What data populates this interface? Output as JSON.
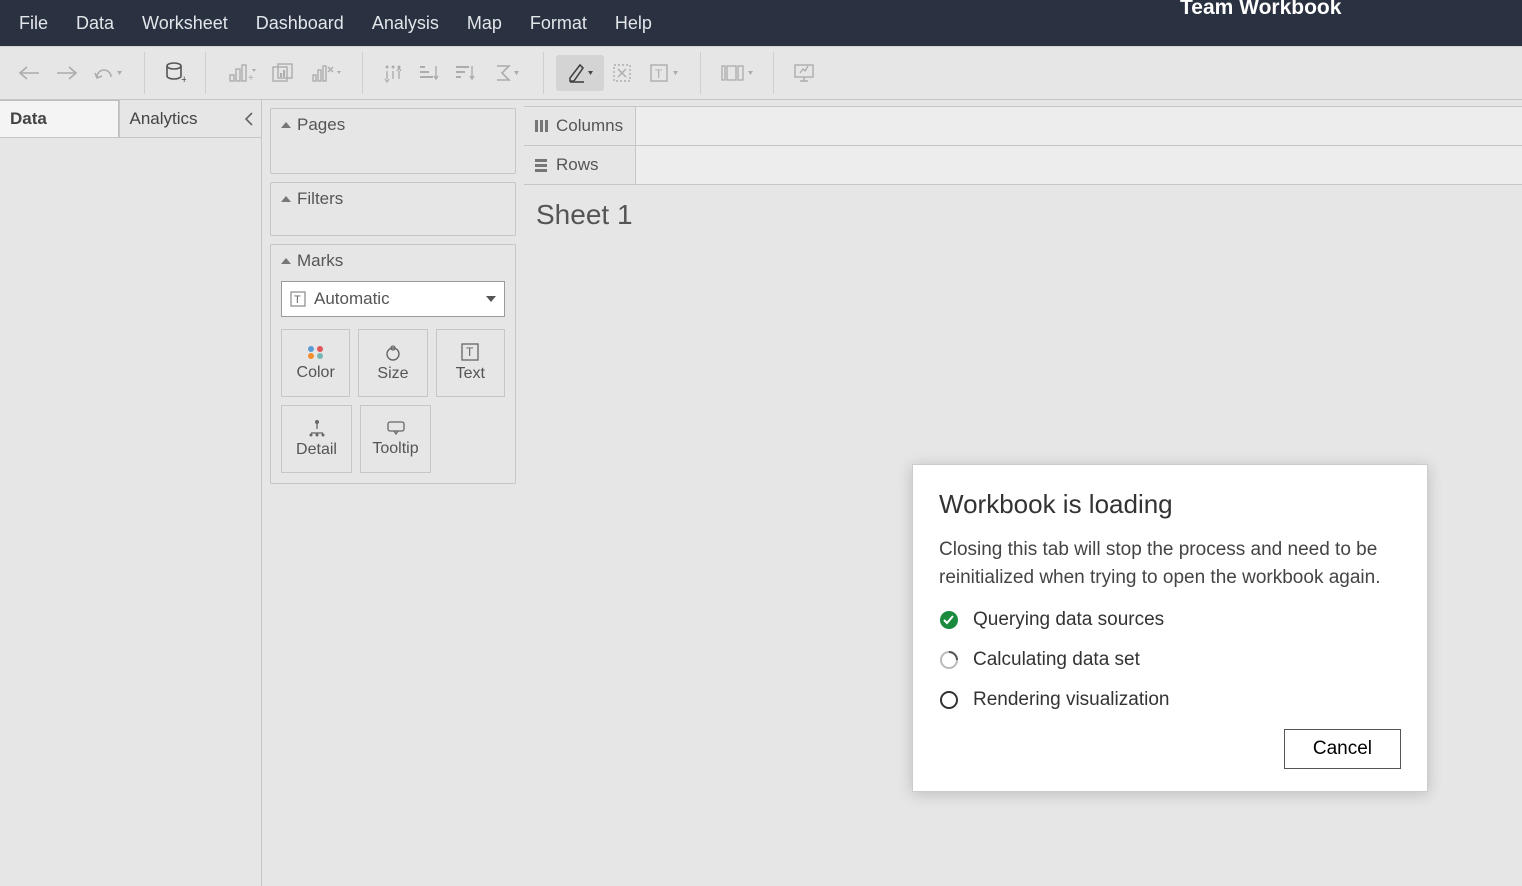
{
  "header": {
    "workbook_title": "Team Workbook"
  },
  "menubar": {
    "items": [
      "File",
      "Data",
      "Worksheet",
      "Dashboard",
      "Analysis",
      "Map",
      "Format",
      "Help"
    ]
  },
  "side": {
    "tab_data": "Data",
    "tab_analytics": "Analytics"
  },
  "cards": {
    "pages": "Pages",
    "filters": "Filters",
    "marks": "Marks",
    "mark_type": "Automatic",
    "cells": {
      "color": "Color",
      "size": "Size",
      "text": "Text",
      "detail": "Detail",
      "tooltip": "Tooltip"
    }
  },
  "shelves": {
    "columns": "Columns",
    "rows": "Rows"
  },
  "sheet": {
    "title": "Sheet 1"
  },
  "dialog": {
    "title": "Workbook is loading",
    "body": "Closing this tab will stop the process and need to be reinitialized when trying to open the workbook again.",
    "steps": [
      {
        "label": "Querying data sources",
        "state": "done"
      },
      {
        "label": "Calculating data set",
        "state": "active"
      },
      {
        "label": "Rendering visualization",
        "state": "pending"
      }
    ],
    "cancel": "Cancel"
  }
}
